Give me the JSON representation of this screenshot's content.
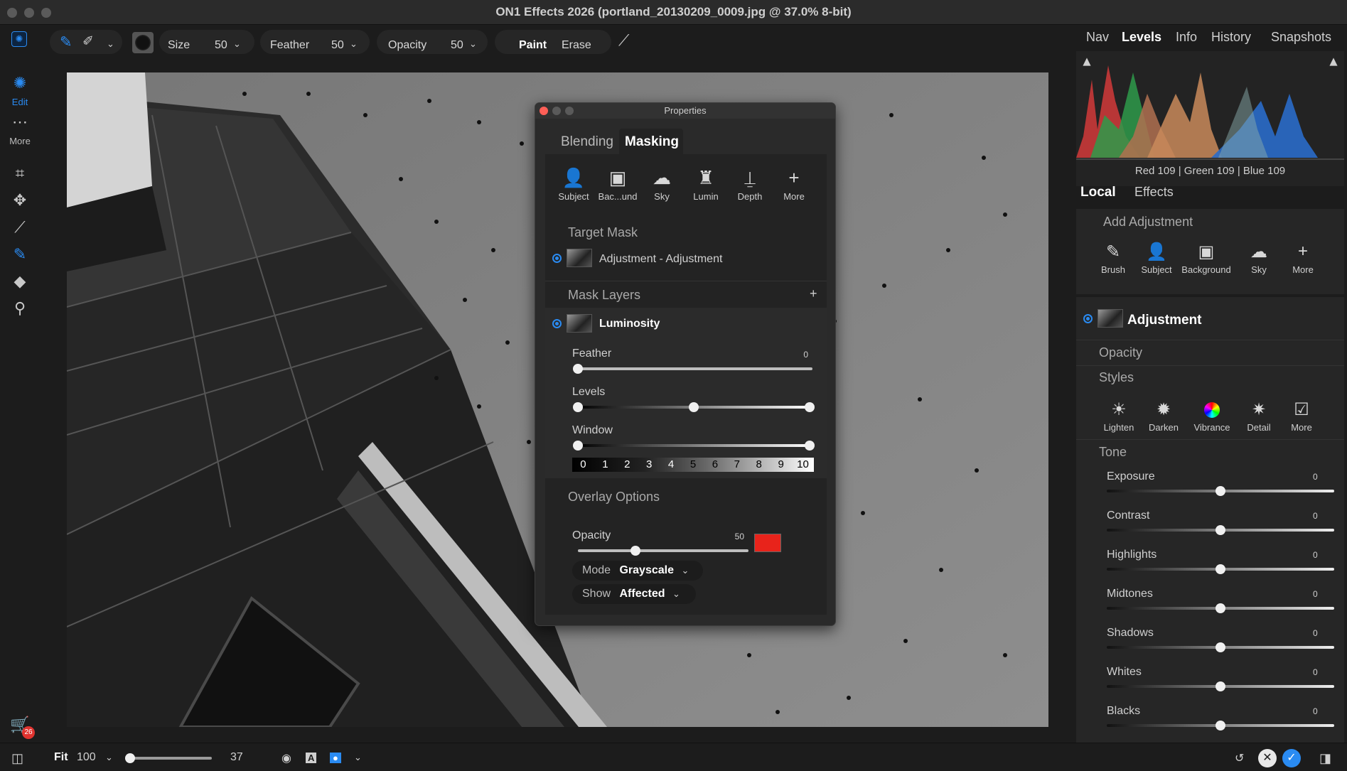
{
  "window": {
    "title": "ON1 Effects 2026 (portland_20130209_0009.jpg @ 37.0% 8-bit)"
  },
  "toolbar": {
    "size_label": "Size",
    "size_value": "50",
    "feather_label": "Feather",
    "feather_value": "50",
    "opacity_label": "Opacity",
    "opacity_value": "50",
    "paint_label": "Paint",
    "erase_label": "Erase"
  },
  "leftrail": {
    "edit_label": "Edit",
    "more_label": "More",
    "cart_badge": "26"
  },
  "properties": {
    "title": "Properties",
    "tabs": {
      "blending": "Blending",
      "masking": "Masking"
    },
    "mask_tools": [
      {
        "icon": "subject-icon",
        "label": "Subject"
      },
      {
        "icon": "background-icon",
        "label": "Bac...und"
      },
      {
        "icon": "sky-icon",
        "label": "Sky"
      },
      {
        "icon": "luminosity-icon",
        "label": "Lumin"
      },
      {
        "icon": "depth-icon",
        "label": "Depth"
      },
      {
        "icon": "plus-icon",
        "label": "More"
      }
    ],
    "target_mask_title": "Target Mask",
    "target_mask_name": "Adjustment - Adjustment",
    "mask_layers_title": "Mask Layers",
    "layer_name": "Luminosity",
    "feather_label": "Feather",
    "feather_value": "0",
    "levels_label": "Levels",
    "window_label": "Window",
    "zone_numbers": [
      "0",
      "1",
      "2",
      "3",
      "4",
      "5",
      "6",
      "7",
      "8",
      "9",
      "10"
    ],
    "overlay_title": "Overlay Options",
    "overlay_opacity_label": "Opacity",
    "overlay_opacity_value": "50",
    "overlay_color": "#e8231b",
    "mode_label": "Mode",
    "mode_value": "Grayscale",
    "show_label": "Show",
    "show_value": "Affected"
  },
  "rightpanel": {
    "tabs": [
      "Nav",
      "Levels",
      "Info",
      "History",
      "Snapshots"
    ],
    "active_tab": "Levels",
    "histogram_readout": "Red 109 | Green 109 | Blue 109",
    "local_tab": "Local",
    "effects_tab": "Effects",
    "add_adjustment_title": "Add Adjustment",
    "add_tools": [
      {
        "icon": "brush-icon",
        "label": "Brush"
      },
      {
        "icon": "subject-icon",
        "label": "Subject"
      },
      {
        "icon": "background-icon",
        "label": "Background"
      },
      {
        "icon": "sky-icon",
        "label": "Sky"
      },
      {
        "icon": "plus-icon",
        "label": "More"
      }
    ],
    "adjustment_title": "Adjustment",
    "opacity_label": "Opacity",
    "styles_label": "Styles",
    "styles": [
      {
        "icon": "lighten-icon",
        "label": "Lighten"
      },
      {
        "icon": "darken-icon",
        "label": "Darken"
      },
      {
        "icon": "vibrance-icon",
        "label": "Vibrance"
      },
      {
        "icon": "detail-icon",
        "label": "Detail"
      },
      {
        "icon": "more-icon",
        "label": "More"
      }
    ],
    "tone_title": "Tone",
    "tone": [
      {
        "label": "Exposure",
        "value": "0"
      },
      {
        "label": "Contrast",
        "value": "0"
      },
      {
        "label": "Highlights",
        "value": "0"
      },
      {
        "label": "Midtones",
        "value": "0"
      },
      {
        "label": "Shadows",
        "value": "0"
      },
      {
        "label": "Whites",
        "value": "0"
      },
      {
        "label": "Blacks",
        "value": "0"
      }
    ]
  },
  "bottombar": {
    "fit_label": "Fit",
    "zoom_value": "100",
    "zoom_readout": "37"
  },
  "colors": {
    "accent": "#2a8bf2",
    "brush_active": "#2a8bf2"
  }
}
